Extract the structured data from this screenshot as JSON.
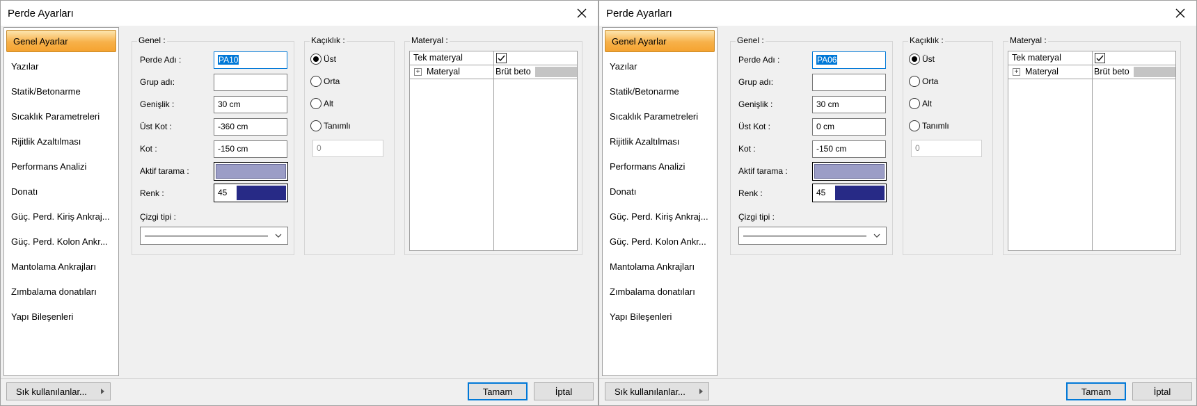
{
  "dialogs": [
    {
      "title": "Perde Ayarları",
      "sidebar": [
        "Genel Ayarlar",
        "Yazılar",
        "Statik/Betonarme",
        "Sıcaklık Parametreleri",
        "Rijitlik Azaltılması",
        "Performans Analizi",
        "Donatı",
        "Güç. Perd. Kiriş Ankraj...",
        "Güç. Perd. Kolon Ankr...",
        "Mantolama Ankrajları",
        "Zımbalama donatıları",
        "Yapı Bileşenleri"
      ],
      "genel": {
        "label": "Genel :",
        "perde_adi_label": "Perde Adı :",
        "perde_adi": "PA10",
        "grup_adi_label": "Grup adı:",
        "grup_adi": "",
        "genislik_label": "Genişlik :",
        "genislik": "30 cm",
        "ust_kot_label": "Üst Kot :",
        "ust_kot": "-360 cm",
        "kot_label": "Kot :",
        "kot": "-150 cm",
        "aktif_tarama_label": "Aktif tarama :",
        "renk_label": "Renk :",
        "renk": "45",
        "cizgi_tipi_label": "Çizgi tipi :"
      },
      "kaciklik": {
        "label": "Kaçıklık :",
        "options": [
          "Üst",
          "Orta",
          "Alt",
          "Tanımlı"
        ],
        "selected": "Üst",
        "value": "0"
      },
      "materyal": {
        "label": "Materyal :",
        "tek_materyal": "Tek materyal",
        "materyal_label": "Materyal",
        "materyal_value": "Brüt beto"
      },
      "footer": {
        "favorites": "Sık kullanılanlar...",
        "ok": "Tamam",
        "cancel": "İptal"
      }
    },
    {
      "title": "Perde Ayarları",
      "sidebar": [
        "Genel Ayarlar",
        "Yazılar",
        "Statik/Betonarme",
        "Sıcaklık Parametreleri",
        "Rijitlik Azaltılması",
        "Performans Analizi",
        "Donatı",
        "Güç. Perd. Kiriş Ankraj...",
        "Güç. Perd. Kolon Ankr...",
        "Mantolama Ankrajları",
        "Zımbalama donatıları",
        "Yapı Bileşenleri"
      ],
      "genel": {
        "label": "Genel :",
        "perde_adi_label": "Perde Adı :",
        "perde_adi": "PA06",
        "grup_adi_label": "Grup adı:",
        "grup_adi": "",
        "genislik_label": "Genişlik :",
        "genislik": "30 cm",
        "ust_kot_label": "Üst Kot :",
        "ust_kot": "0 cm",
        "kot_label": "Kot :",
        "kot": "-150 cm",
        "aktif_tarama_label": "Aktif tarama :",
        "renk_label": "Renk :",
        "renk": "45",
        "cizgi_tipi_label": "Çizgi tipi :"
      },
      "kaciklik": {
        "label": "Kaçıklık :",
        "options": [
          "Üst",
          "Orta",
          "Alt",
          "Tanımlı"
        ],
        "selected": "Üst",
        "value": "0"
      },
      "materyal": {
        "label": "Materyal :",
        "tek_materyal": "Tek materyal",
        "materyal_label": "Materyal",
        "materyal_value": "Brüt beto"
      },
      "footer": {
        "favorites": "Sık kullanılanlar...",
        "ok": "Tamam",
        "cancel": "İptal"
      }
    }
  ],
  "colors": {
    "accent": "#0078d7",
    "active_sidebar": "#f7b14a",
    "aktif_tarama_fill": "#9b9dc6",
    "renk_fill": "#272a86"
  }
}
